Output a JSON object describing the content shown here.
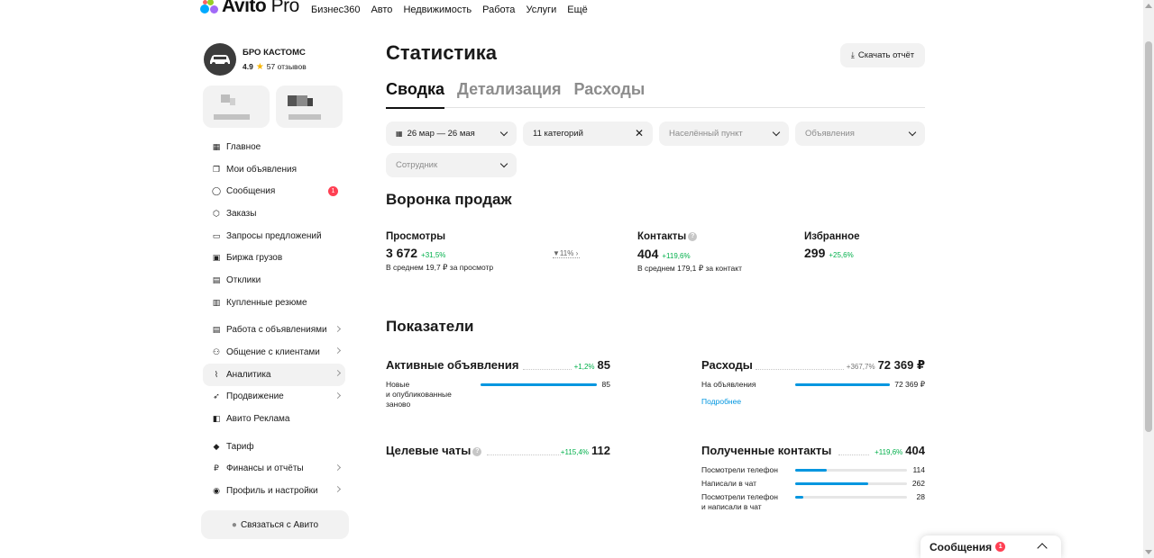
{
  "topnav": {
    "logo_main": "Avito",
    "logo_suffix": "Pro",
    "links": [
      "Бизнес360",
      "Авто",
      "Недвижимость",
      "Работа",
      "Услуги",
      "Ещё"
    ]
  },
  "profile": {
    "name": "БРО КАСТОМС",
    "rating": "4.9",
    "reviews": "57 отзывов"
  },
  "sidebar": {
    "group1": [
      {
        "label": "Главное",
        "icon": "grid-icon"
      },
      {
        "label": "Мои объявления",
        "icon": "copy-icon"
      },
      {
        "label": "Сообщения",
        "icon": "chat-icon",
        "badge": "1"
      },
      {
        "label": "Заказы",
        "icon": "box-icon"
      },
      {
        "label": "Запросы предложений",
        "icon": "folder-icon"
      },
      {
        "label": "Биржа грузов",
        "icon": "truck-icon"
      },
      {
        "label": "Отклики",
        "icon": "inbox-icon"
      },
      {
        "label": "Купленные резюме",
        "icon": "resume-icon"
      }
    ],
    "group2": [
      {
        "label": "Работа с объявлениями",
        "icon": "list-icon",
        "chevron": true
      },
      {
        "label": "Общение с клиентами",
        "icon": "people-icon",
        "chevron": true
      },
      {
        "label": "Аналитика",
        "icon": "chart-icon",
        "chevron": true,
        "active": true
      },
      {
        "label": "Продвижение",
        "icon": "rocket-icon",
        "chevron": true
      },
      {
        "label": "Авито Реклама",
        "icon": "megaphone-icon"
      }
    ],
    "group3": [
      {
        "label": "Тариф",
        "icon": "diamond-icon"
      },
      {
        "label": "Финансы и отчёты",
        "icon": "ruble-icon",
        "chevron": true
      },
      {
        "label": "Профиль и настройки",
        "icon": "user-icon",
        "chevron": true
      }
    ],
    "contact_button": "Связаться с Авито"
  },
  "main": {
    "title": "Статистика",
    "download_button": "Скачать отчёт",
    "tabs": [
      "Сводка",
      "Детализация",
      "Расходы"
    ],
    "filters": {
      "period": "26 мар — 26 мая",
      "categories": "11 категорий",
      "city_placeholder": "Населённый пункт",
      "ads_placeholder": "Объявления",
      "employee_placeholder": "Сотрудник"
    },
    "funnel": {
      "title": "Воронка продаж",
      "views": {
        "label": "Просмотры",
        "value": "3 672",
        "delta": "+31,5%",
        "sub": "В среднем 19,7 ₽ за просмотр"
      },
      "conversion": "11%",
      "contacts": {
        "label": "Контакты",
        "value": "404",
        "delta": "+119,6%",
        "sub": "В среднем 179,1 ₽ за контакт"
      },
      "favorites": {
        "label": "Избранное",
        "value": "299",
        "delta": "+25,6%"
      }
    },
    "indicators": {
      "title": "Показатели",
      "active_ads": {
        "title": "Активные объявления",
        "delta": "+1,2%",
        "value": "85",
        "rows": [
          {
            "label": "Новые\nи опубликованные\nзаново",
            "value": "85",
            "fill": 1.0
          }
        ]
      },
      "expenses": {
        "title": "Расходы",
        "delta": "+367,7%",
        "value": "72 369 ₽",
        "rows": [
          {
            "label": "На объявления",
            "value": "72 369 ₽",
            "fill": 1.0
          }
        ],
        "link": "Подробнее"
      },
      "target_chats": {
        "title": "Целевые чаты",
        "delta": "+115,4%",
        "value": "112"
      },
      "contacts": {
        "title": "Полученные контакты",
        "delta": "+119,6%",
        "value": "404",
        "rows": [
          {
            "label": "Посмотрели телефон",
            "value": "114",
            "fill": 0.28
          },
          {
            "label": "Написали в чат",
            "value": "262",
            "fill": 0.65
          },
          {
            "label": "Посмотрели телефон\nи написали в чат",
            "value": "28",
            "fill": 0.07
          }
        ]
      }
    }
  },
  "messages_widget": {
    "label": "Сообщения",
    "badge": "1"
  },
  "colors": {
    "accent_blue": "#0096e0",
    "delta_green": "#03b04c",
    "badge_red": "#ff4053"
  }
}
